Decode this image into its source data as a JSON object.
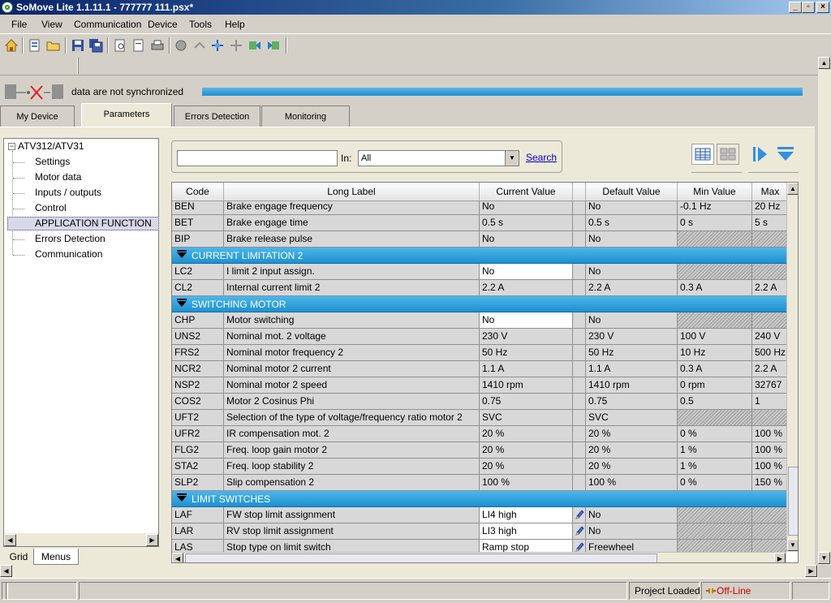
{
  "window": {
    "title": "SoMove Lite 1.1.11.1 - 777777 111.psx*"
  },
  "menu": [
    "File",
    "View",
    "Communication",
    "Device",
    "Tools",
    "Help"
  ],
  "sync": {
    "status_text": "data are not synchronized"
  },
  "tabs": [
    "My Device",
    "Parameters",
    "Errors Detection",
    "Monitoring"
  ],
  "tree": {
    "root": "ATV312/ATV31",
    "items": [
      "Settings",
      "Motor data",
      "Inputs / outputs",
      "Control",
      "APPLICATION FUNCTION",
      "Errors Detection",
      "Communication"
    ]
  },
  "bottom_tabs": [
    "Grid",
    "Menus"
  ],
  "search": {
    "value": "",
    "in_label": "In:",
    "scope": "All",
    "button": "Search"
  },
  "grid": {
    "columns": [
      "Code",
      "Long Label",
      "Current Value",
      "Default Value",
      "Min Value",
      "Max"
    ],
    "rows": [
      {
        "type": "row",
        "code": "BEN",
        "label": "Brake engage frequency",
        "current": "No",
        "default": "No",
        "min": "-0.1 Hz",
        "max": "20 Hz"
      },
      {
        "type": "row",
        "code": "BET",
        "label": "Brake engage time",
        "current": "0.5 s",
        "default": "0.5 s",
        "min": "0 s",
        "max": "5 s"
      },
      {
        "type": "row",
        "code": "BIP",
        "label": "Brake release pulse",
        "current": "No",
        "default": "No",
        "min": "",
        "max": "",
        "hatch": true
      },
      {
        "type": "group",
        "label": "CURRENT LIMITATION 2"
      },
      {
        "type": "row",
        "code": "LC2",
        "label": "I limit 2 input assign.",
        "current": "No",
        "default": "No",
        "min": "",
        "max": "",
        "hatch": true,
        "white": true
      },
      {
        "type": "row",
        "code": "CL2",
        "label": "Internal current limit 2",
        "current": "2.2 A",
        "default": "2.2 A",
        "min": "0.3 A",
        "max": "2.2 A"
      },
      {
        "type": "group",
        "label": "SWITCHING MOTOR"
      },
      {
        "type": "row",
        "code": "CHP",
        "label": "Motor switching",
        "current": "No",
        "default": "No",
        "min": "",
        "max": "",
        "hatch": true,
        "white": true
      },
      {
        "type": "row",
        "code": "UNS2",
        "label": "Nominal mot. 2 voltage",
        "current": "230 V",
        "default": "230 V",
        "min": "100 V",
        "max": "240 V"
      },
      {
        "type": "row",
        "code": "FRS2",
        "label": "Nominal motor frequency 2",
        "current": "50 Hz",
        "default": "50 Hz",
        "min": "10 Hz",
        "max": "500 Hz"
      },
      {
        "type": "row",
        "code": "NCR2",
        "label": "Nominal motor 2 current",
        "current": "1.1 A",
        "default": "1.1 A",
        "min": "0.3 A",
        "max": "2.2 A"
      },
      {
        "type": "row",
        "code": "NSP2",
        "label": "Nominal motor 2 speed",
        "current": "1410 rpm",
        "default": "1410 rpm",
        "min": "0 rpm",
        "max": "32767"
      },
      {
        "type": "row",
        "code": "COS2",
        "label": "Motor 2 Cosinus Phi",
        "current": "0.75",
        "default": "0.75",
        "min": "0.5",
        "max": "1"
      },
      {
        "type": "row",
        "code": "UFT2",
        "label": "Selection of the type of voltage/frequency ratio motor 2",
        "current": "SVC",
        "default": "SVC",
        "min": "",
        "max": "",
        "hatch": true
      },
      {
        "type": "row",
        "code": "UFR2",
        "label": "IR compensation mot. 2",
        "current": "20 %",
        "default": "20 %",
        "min": "0 %",
        "max": "100 %"
      },
      {
        "type": "row",
        "code": "FLG2",
        "label": "Freq. loop gain motor 2",
        "current": "20 %",
        "default": "20 %",
        "min": "1 %",
        "max": "100 %"
      },
      {
        "type": "row",
        "code": "STA2",
        "label": "Freq. loop stability 2",
        "current": "20 %",
        "default": "20 %",
        "min": "1 %",
        "max": "100 %"
      },
      {
        "type": "row",
        "code": "SLP2",
        "label": "Slip compensation 2",
        "current": "100 %",
        "default": "100 %",
        "min": "0 %",
        "max": "150 %"
      },
      {
        "type": "group",
        "label": "LIMIT SWITCHES"
      },
      {
        "type": "row",
        "code": "LAF",
        "label": "FW stop limit assignment",
        "current": "LI4 high",
        "default": "No",
        "min": "",
        "max": "",
        "hatch": true,
        "white": true,
        "edit": true
      },
      {
        "type": "row",
        "code": "LAR",
        "label": "RV stop limit assignment",
        "current": "LI3 high",
        "default": "No",
        "min": "",
        "max": "",
        "hatch": true,
        "white": true,
        "edit": true
      },
      {
        "type": "row",
        "code": "LAS",
        "label": "Stop type on limit switch",
        "current": "Ramp stop",
        "default": "Freewheel",
        "min": "",
        "max": "",
        "hatch": true,
        "white": true,
        "edit": true
      }
    ]
  },
  "status": {
    "project": "Project Loaded",
    "connection": "Off-Line",
    "connection_color": "#cc0000"
  },
  "colors": {
    "group_bar": "#2ea3de",
    "sync_bar": "#3aa6e0"
  }
}
